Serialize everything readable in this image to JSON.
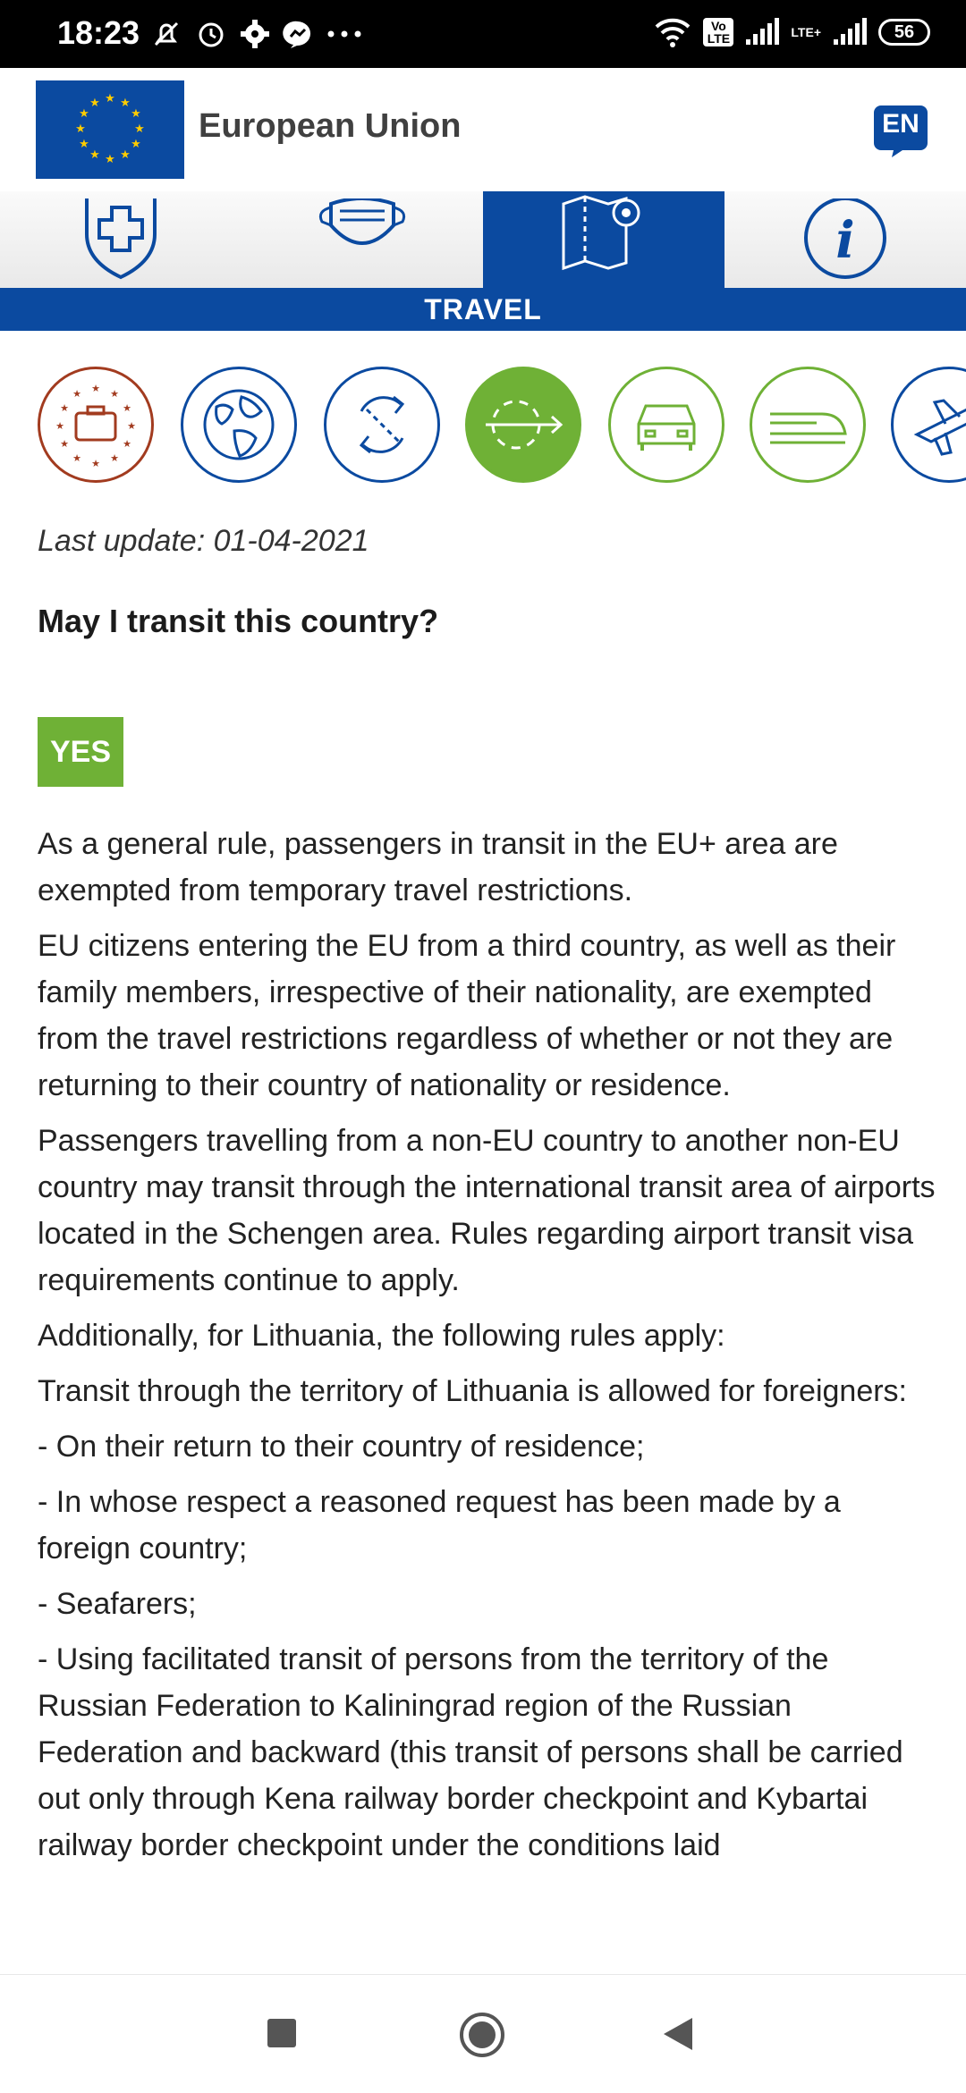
{
  "status_bar": {
    "time": "18:23",
    "network_badge": "Vo LTE",
    "lte_label": "LTE+",
    "battery": "56"
  },
  "header": {
    "brand": "European Union",
    "language": "EN",
    "colors": {
      "primary": "#0b4aa0",
      "yes": "#6fb136",
      "stars": "#ffcc00"
    }
  },
  "categories": [
    {
      "icon": "health-shield-icon"
    },
    {
      "icon": "face-mask-icon"
    },
    {
      "icon": "travel-map-icon",
      "active": true
    },
    {
      "icon": "info-icon"
    }
  ],
  "section_title": "TRAVEL",
  "sub_categories": [
    {
      "icon": "luggage-icon"
    },
    {
      "icon": "globe-icon"
    },
    {
      "icon": "return-icon"
    },
    {
      "icon": "transit-icon",
      "active": true
    },
    {
      "icon": "car-icon"
    },
    {
      "icon": "train-icon"
    },
    {
      "icon": "plane-icon"
    }
  ],
  "content": {
    "last_update": "Last update: 01-04-2021",
    "question": "May I transit this country?",
    "answer": "YES",
    "paragraphs": [
      "As a general rule, passengers in transit in the EU+ area are exempted from temporary travel restrictions.",
      "EU citizens entering the EU from a third country, as well as their family members, irrespective of their nationality, are exempted from the travel restrictions regardless of whether or not they are returning to their country of nationality or residence.",
      "Passengers travelling from a non-EU country to another non-EU country may transit through the international transit area of airports located in the Schengen area. Rules regarding airport transit visa requirements continue to apply.",
      "Additionally, for Lithuania, the following rules apply:",
      "Transit through the territory of Lithuania is allowed for foreigners:",
      "- On their return to their country of residence;",
      "- In whose respect a reasoned request has been made by a foreign country;",
      "- Seafarers;",
      "- Using facilitated transit of persons from the territory of the Russian Federation to Kaliningrad region of the Russian Federation and backward (this transit of persons shall be carried out only through Kena railway border checkpoint and Kybartai railway border checkpoint under the conditions laid"
    ]
  },
  "nav": {
    "recents": "recents-square-icon",
    "home": "home-circle-icon",
    "back": "back-triangle-icon"
  }
}
